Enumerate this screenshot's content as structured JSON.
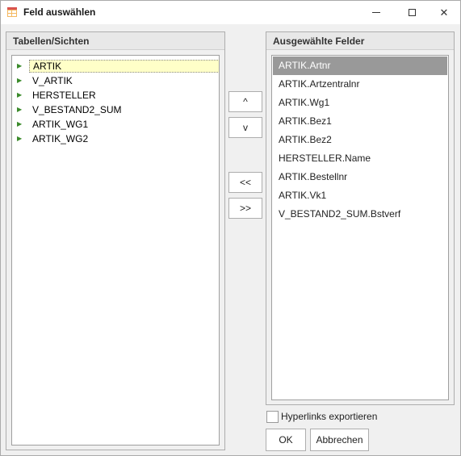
{
  "window": {
    "title": "Feld auswählen",
    "icon": "table-grid-icon",
    "close_symbol": "✕"
  },
  "tables_group": {
    "header": "Tabellen/Sichten",
    "items": [
      {
        "label": "ARTIK",
        "selected": true
      },
      {
        "label": "V_ARTIK",
        "selected": false
      },
      {
        "label": "HERSTELLER",
        "selected": false
      },
      {
        "label": "V_BESTAND2_SUM",
        "selected": false
      },
      {
        "label": "ARTIK_WG1",
        "selected": false
      },
      {
        "label": "ARTIK_WG2",
        "selected": false
      }
    ],
    "expander_symbol": "▶"
  },
  "move_buttons": {
    "up": "^",
    "down": "v",
    "remove": "<<",
    "add": ">>"
  },
  "fields_group": {
    "header": "Ausgewählte Felder",
    "items": [
      {
        "label": "ARTIK.Artnr",
        "selected": true
      },
      {
        "label": "ARTIK.Artzentralnr",
        "selected": false
      },
      {
        "label": "ARTIK.Wg1",
        "selected": false
      },
      {
        "label": "ARTIK.Bez1",
        "selected": false
      },
      {
        "label": "ARTIK.Bez2",
        "selected": false
      },
      {
        "label": "HERSTELLER.Name",
        "selected": false
      },
      {
        "label": "ARTIK.Bestellnr",
        "selected": false
      },
      {
        "label": "ARTIK.Vk1",
        "selected": false
      },
      {
        "label": "V_BESTAND2_SUM.Bstverf",
        "selected": false
      }
    ]
  },
  "options": {
    "hyperlinks_label": "Hyperlinks exportieren",
    "hyperlinks_checked": false
  },
  "footer": {
    "ok_label": "OK",
    "cancel_label": "Abbrechen"
  },
  "colors": {
    "selection_gray": "#999999",
    "tree_highlight": "#ffffc8",
    "expander_green": "#3a8a2a"
  }
}
